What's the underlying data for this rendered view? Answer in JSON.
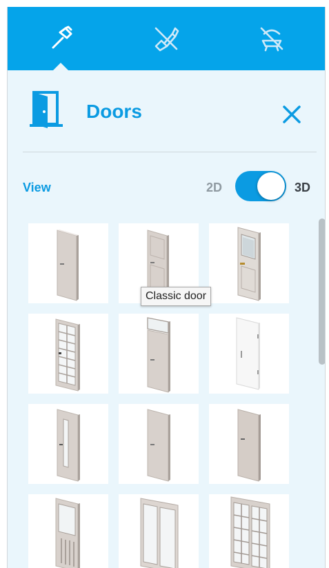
{
  "toolbar": {
    "tabs": [
      {
        "icon": "hammer-icon",
        "active": true
      },
      {
        "icon": "paint-brush-icon",
        "active": false
      },
      {
        "icon": "furniture-icon",
        "active": false
      }
    ],
    "color": "#05a4ea"
  },
  "header": {
    "icon": "door-icon",
    "title": "Doors",
    "close_icon": "close-icon"
  },
  "view": {
    "label": "View",
    "option_2d": "2D",
    "option_3d": "3D",
    "selected": "3D"
  },
  "catalog": {
    "items": [
      {
        "name": "plain-door"
      },
      {
        "name": "classic-door"
      },
      {
        "name": "glass-panel-door"
      },
      {
        "name": "grid-glass-door"
      },
      {
        "name": "transom-door"
      },
      {
        "name": "white-door"
      },
      {
        "name": "narrow-glass-door"
      },
      {
        "name": "plain-door-2"
      },
      {
        "name": "plain-door-3"
      },
      {
        "name": "half-glass-door"
      },
      {
        "name": "double-glass-door"
      },
      {
        "name": "double-grid-door"
      }
    ]
  },
  "tooltip": {
    "text": "Classic door"
  },
  "colors": {
    "accent": "#0b9be2",
    "panel_bg": "#eaf6fc"
  }
}
